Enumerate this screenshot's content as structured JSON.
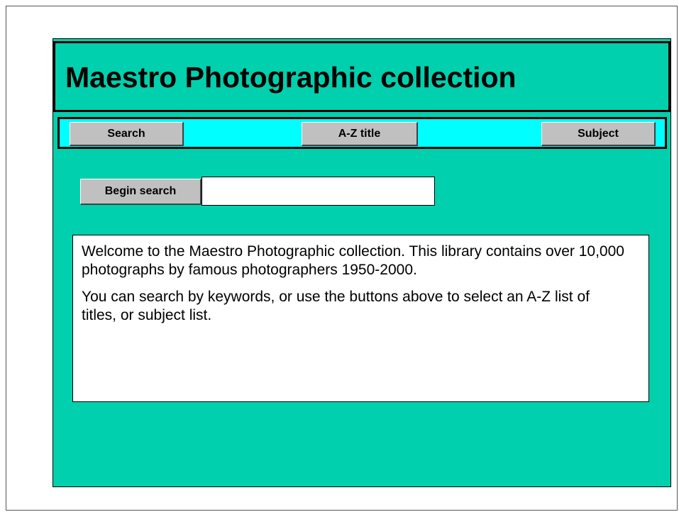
{
  "header": {
    "title": "Maestro Photographic collection"
  },
  "nav": {
    "items": [
      {
        "label": "Search"
      },
      {
        "label": "A-Z title"
      },
      {
        "label": "Subject"
      }
    ]
  },
  "search": {
    "button_label": "Begin search",
    "input_value": "",
    "placeholder": ""
  },
  "welcome": {
    "paragraphs": [
      "Welcome to the Maestro Photographic collection. This library contains over 10,000 photographs by famous photographers 1950-2000.",
      "You can search by keywords, or use the buttons above to select an A-Z list of titles, or subject list."
    ]
  },
  "colors": {
    "page_background": "#00d0ad",
    "nav_background": "#00ffff",
    "button_face": "#c0c0c0",
    "text": "#000000"
  }
}
